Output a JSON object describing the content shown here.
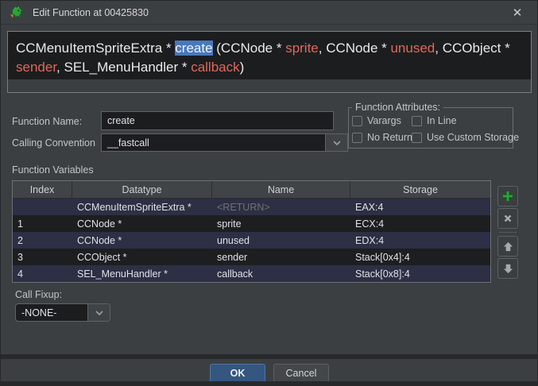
{
  "window": {
    "title": "Edit Function at 00425830",
    "close_glyph": "✕"
  },
  "signature": {
    "segments": [
      {
        "text": "CCMenuItemSpriteExtra * ",
        "style": "plain"
      },
      {
        "text": "create",
        "style": "selected"
      },
      {
        "text": " (CCNode * ",
        "style": "plain"
      },
      {
        "text": "sprite",
        "style": "param"
      },
      {
        "text": ", CCNode * ",
        "style": "plain"
      },
      {
        "text": "unused",
        "style": "param"
      },
      {
        "text": ", CCObject * ",
        "style": "plain"
      },
      {
        "text": "sender",
        "style": "param"
      },
      {
        "text": ", SEL_MenuHandler * ",
        "style": "plain"
      },
      {
        "text": "callback",
        "style": "param"
      },
      {
        "text": ")",
        "style": "plain"
      }
    ]
  },
  "form": {
    "function_name": {
      "label": "Function Name:",
      "value": "create"
    },
    "calling_convention": {
      "label": "Calling Convention",
      "value": "__fastcall"
    }
  },
  "attributes": {
    "title": "Function Attributes:",
    "checkboxes": [
      {
        "label": "Varargs",
        "checked": false
      },
      {
        "label": "In Line",
        "checked": false
      },
      {
        "label": "No Return",
        "checked": false
      },
      {
        "label": "Use Custom Storage",
        "checked": false
      }
    ]
  },
  "variables": {
    "section_label": "Function Variables",
    "columns": [
      "Index",
      "Datatype",
      "Name",
      "Storage"
    ],
    "rows": [
      {
        "index": "",
        "datatype": "CCMenuItemSpriteExtra *",
        "name": "<RETURN>",
        "storage": "EAX:4",
        "return_row": true
      },
      {
        "index": "1",
        "datatype": "CCNode *",
        "name": "sprite",
        "storage": "ECX:4",
        "return_row": false
      },
      {
        "index": "2",
        "datatype": "CCNode *",
        "name": "unused",
        "storage": "EDX:4",
        "return_row": false
      },
      {
        "index": "3",
        "datatype": "CCObject *",
        "name": "sender",
        "storage": "Stack[0x4]:4",
        "return_row": false
      },
      {
        "index": "4",
        "datatype": "SEL_MenuHandler *",
        "name": "callback",
        "storage": "Stack[0x8]:4",
        "return_row": false
      }
    ],
    "side_buttons": [
      {
        "name": "add",
        "icon": "plus-icon"
      },
      {
        "name": "delete",
        "icon": "delete-x-icon"
      },
      {
        "name": "move-up",
        "icon": "arrow-up-icon"
      },
      {
        "name": "move-down",
        "icon": "arrow-down-icon"
      }
    ]
  },
  "call_fixup": {
    "label": "Call Fixup:",
    "value": "-NONE-"
  },
  "footer": {
    "ok_label": "OK",
    "cancel_label": "Cancel"
  },
  "colors": {
    "dialog_bg": "#3c3f41",
    "editor_bg": "#1c1d1f",
    "param_text": "#e0685a",
    "selection_bg": "#4878bc",
    "row_alt_bg": "#2d2f44",
    "row_dark_bg": "#1d1e20",
    "ok_button_bg": "#34567f",
    "add_icon_green": "#2fa33c"
  }
}
